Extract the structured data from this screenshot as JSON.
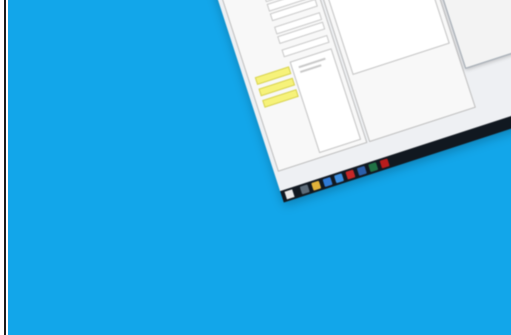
{
  "colors": {
    "background": "#12a6ea",
    "highlight_yellow": "#f6f27a",
    "app_icon_red": "#c62828",
    "taskbar": "#111820"
  },
  "app": {
    "header_field": "",
    "left_panel_label": "",
    "list_panel_label": "",
    "dialog_title": "",
    "dialog_button_1": "",
    "dialog_button_2": ""
  },
  "taskbar": {
    "icons": [
      "start-icon",
      "search-icon",
      "explorer-icon",
      "browser-icon",
      "mail-icon",
      "app-icon",
      "word-icon",
      "excel-icon",
      "pdf-icon"
    ]
  }
}
